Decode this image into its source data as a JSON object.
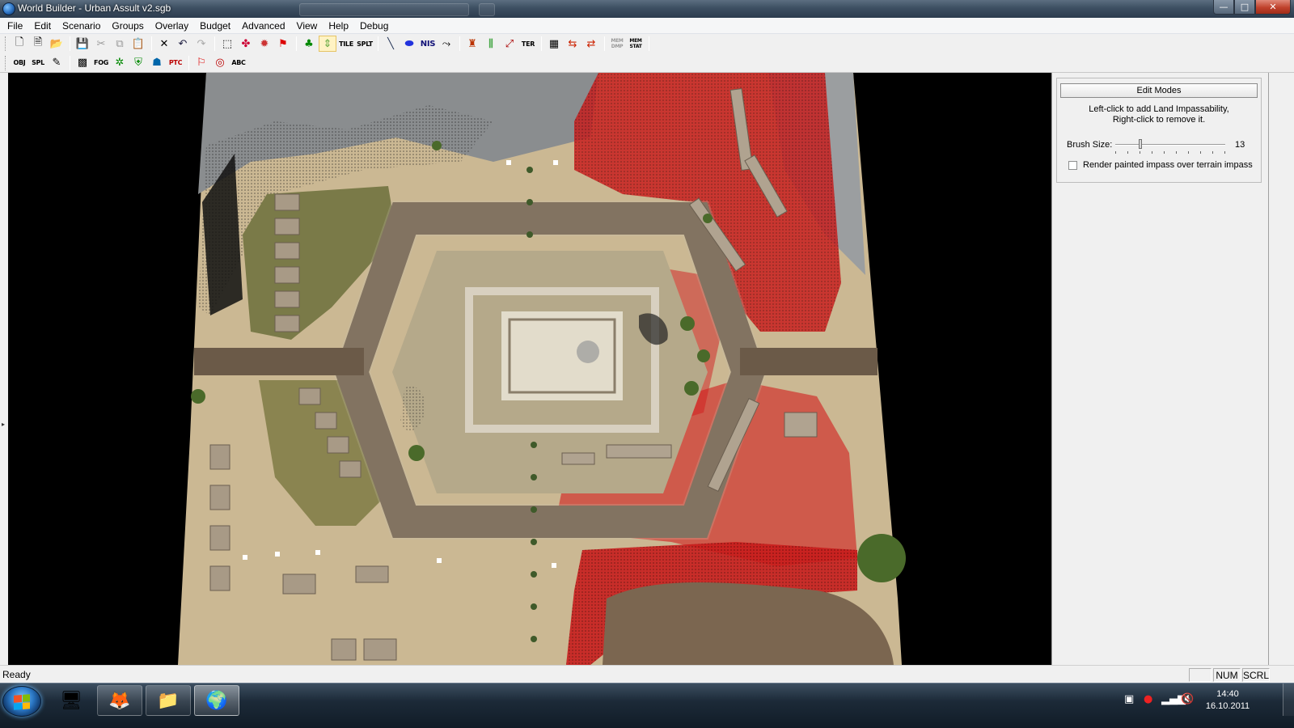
{
  "window": {
    "title": "World Builder - Urban Assult v2.sgb",
    "min_glyph": "—",
    "max_glyph": "□",
    "close_glyph": "✕"
  },
  "menu": [
    "File",
    "Edit",
    "Scenario",
    "Groups",
    "Overlay",
    "Budget",
    "Advanced",
    "View",
    "Help",
    "Debug"
  ],
  "toolbar1": {
    "tile_label": "TILE",
    "splt_label": "SPLT",
    "nis_label": "NIS",
    "ter_label": "TER",
    "mem_dmp_label": "MEM DMP",
    "mem_stat_label": "MEM STAT"
  },
  "toolbar2": {
    "obj_label": "OBJ",
    "spl_label": "SPL",
    "fog_label": "FOG",
    "ptc_label": "PTC",
    "abc_label": "ABC"
  },
  "panel": {
    "edit_modes_label": "Edit Modes",
    "instruction_line1": "Left-click to add Land Impassability,",
    "instruction_line2": "Right-click to remove it.",
    "brush_label": "Brush Size:",
    "brush_value": "13",
    "brush_fraction": 0.22,
    "render_option_label": "Render painted impass over terrain impass",
    "render_option_checked": false
  },
  "status": {
    "text": "Ready",
    "num": "NUM",
    "scrl": "SCRL"
  },
  "taskbar": {
    "time": "14:40",
    "date": "16.10.2011"
  },
  "colors": {
    "impass_paint": "#d81e1e",
    "road": "#6b5a48",
    "sand": "#c9b48c"
  }
}
